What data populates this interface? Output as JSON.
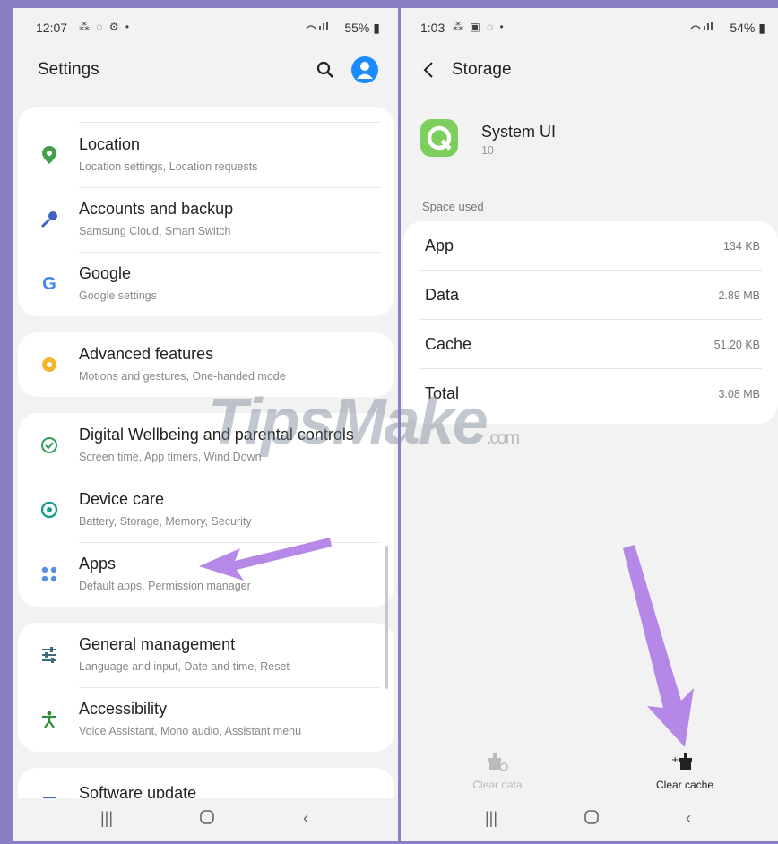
{
  "left": {
    "status": {
      "time": "12:07",
      "icons": "⁂ ◌ ⚙ •",
      "battery": "55%"
    },
    "title": "Settings",
    "items": [
      {
        "title": "Location",
        "subtitle": "Location settings, Location requests"
      },
      {
        "title": "Accounts and backup",
        "subtitle": "Samsung Cloud, Smart Switch"
      },
      {
        "title": "Google",
        "subtitle": "Google settings"
      },
      {
        "title": "Advanced features",
        "subtitle": "Motions and gestures, One-handed mode"
      },
      {
        "title": "Digital Wellbeing and parental controls",
        "subtitle": "Screen time, App timers, Wind Down"
      },
      {
        "title": "Device care",
        "subtitle": "Battery, Storage, Memory, Security"
      },
      {
        "title": "Apps",
        "subtitle": "Default apps, Permission manager"
      },
      {
        "title": "General management",
        "subtitle": "Language and input, Date and time, Reset"
      },
      {
        "title": "Accessibility",
        "subtitle": "Voice Assistant, Mono audio, Assistant menu"
      },
      {
        "title": "Software update",
        "subtitle": ""
      }
    ],
    "google_glyph": "G"
  },
  "right": {
    "status": {
      "time": "1:03",
      "icons": "⁂ ▣ ◌ •",
      "battery": "54%"
    },
    "title": "Storage",
    "app_name": "System UI",
    "app_version": "10",
    "section_label": "Space used",
    "rows": [
      {
        "label": "App",
        "value": "134 KB"
      },
      {
        "label": "Data",
        "value": "2.89 MB"
      },
      {
        "label": "Cache",
        "value": "51.20 KB"
      },
      {
        "label": "Total",
        "value": "3.08 MB"
      }
    ],
    "clear_data_label": "Clear data",
    "clear_cache_label": "Clear cache"
  },
  "watermark": {
    "main": "TipsMake",
    "suffix": ".com"
  },
  "colors": {
    "accent": "#1a8cff",
    "arrow": "#b07ee6",
    "location": "#43a047",
    "google_blue": "#4285f4"
  }
}
